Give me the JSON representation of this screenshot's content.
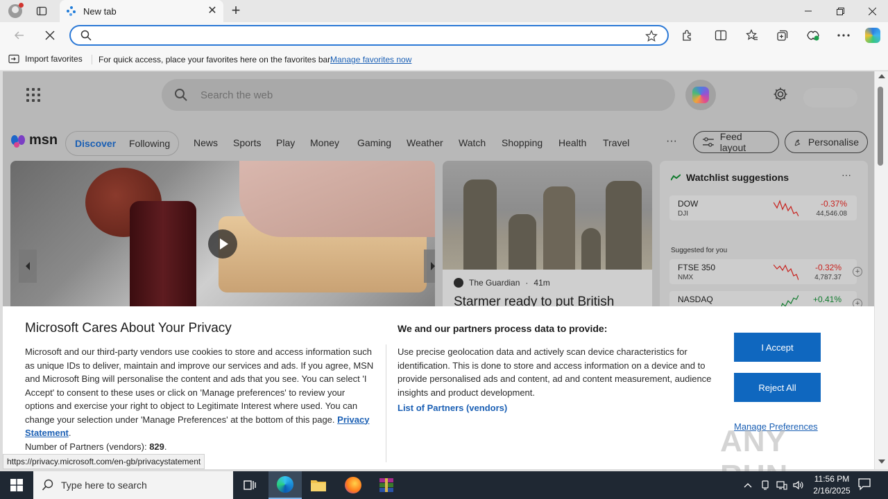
{
  "browser": {
    "tab_title": "New tab",
    "address_value": "",
    "favorites_bar": {
      "import_label": "Import favorites",
      "hint": "For quick access, place your favorites here on the favorites bar.",
      "manage_link": "Manage favorites now"
    }
  },
  "msn": {
    "search_placeholder": "Search the web",
    "logo_text": "msn",
    "tabs": [
      "Discover",
      "Following"
    ],
    "nav": [
      "News",
      "Sports",
      "Play",
      "Money",
      "Gaming",
      "Weather",
      "Watch",
      "Shopping",
      "Health",
      "Travel"
    ],
    "more": "···",
    "feed_layout_label": "Feed layout",
    "personalise_label": "Personalise",
    "card2": {
      "source": "The Guardian",
      "age": "41m",
      "headline": "Starmer ready to put British"
    },
    "watchlist": {
      "title": "Watchlist suggestions",
      "menu": "···",
      "suggested_label": "Suggested for you",
      "items": [
        {
          "symbol": "DOW",
          "exchange": "DJI",
          "change": "-0.37%",
          "price": "44,546.08",
          "direction": "down"
        },
        {
          "symbol": "FTSE 350",
          "exchange": "NMX",
          "change": "-0.32%",
          "price": "4,787.37",
          "direction": "down"
        },
        {
          "symbol": "NASDAQ",
          "exchange": "",
          "change": "+0.41%",
          "price": "",
          "direction": "up"
        }
      ],
      "colors": {
        "down": "#c8211d",
        "up": "#0f7a2c"
      }
    }
  },
  "privacy": {
    "title": "Microsoft Cares About Your Privacy",
    "body": "Microsoft and our third-party vendors use cookies to store and access information such as unique IDs to deliver, maintain and improve our services and ads. If you agree, MSN and Microsoft Bing will personalise the content and ads that you see. You can select 'I Accept' to consent to these uses or click on 'Manage preferences' to review your options and exercise your right to object to Legitimate Interest where used.  You can change your selection under 'Manage Preferences' at the bottom of this page.",
    "privacy_link": "Privacy Statement",
    "partners_count_label": "Number of Partners (vendors):",
    "partners_count": "829",
    "purposes_title": "We and our partners process data to provide:",
    "purposes_text": "Use precise geolocation data and actively scan device characteristics for identification. This is done to store and access information on a device and to provide personalised ads and content, ad and content measurement, audience insights and product development.",
    "partners_link": "List of Partners (vendors)",
    "accept_label": "I Accept",
    "reject_label": "Reject All",
    "manage_label": "Manage Preferences",
    "accent": "#0f67bf"
  },
  "status_url": "https://privacy.microsoft.com/en-gb/privacystatement",
  "watermark_text": "ANY RUN",
  "taskbar": {
    "search_placeholder": "Type here to search",
    "time": "11:56 PM",
    "date": "2/16/2025"
  }
}
